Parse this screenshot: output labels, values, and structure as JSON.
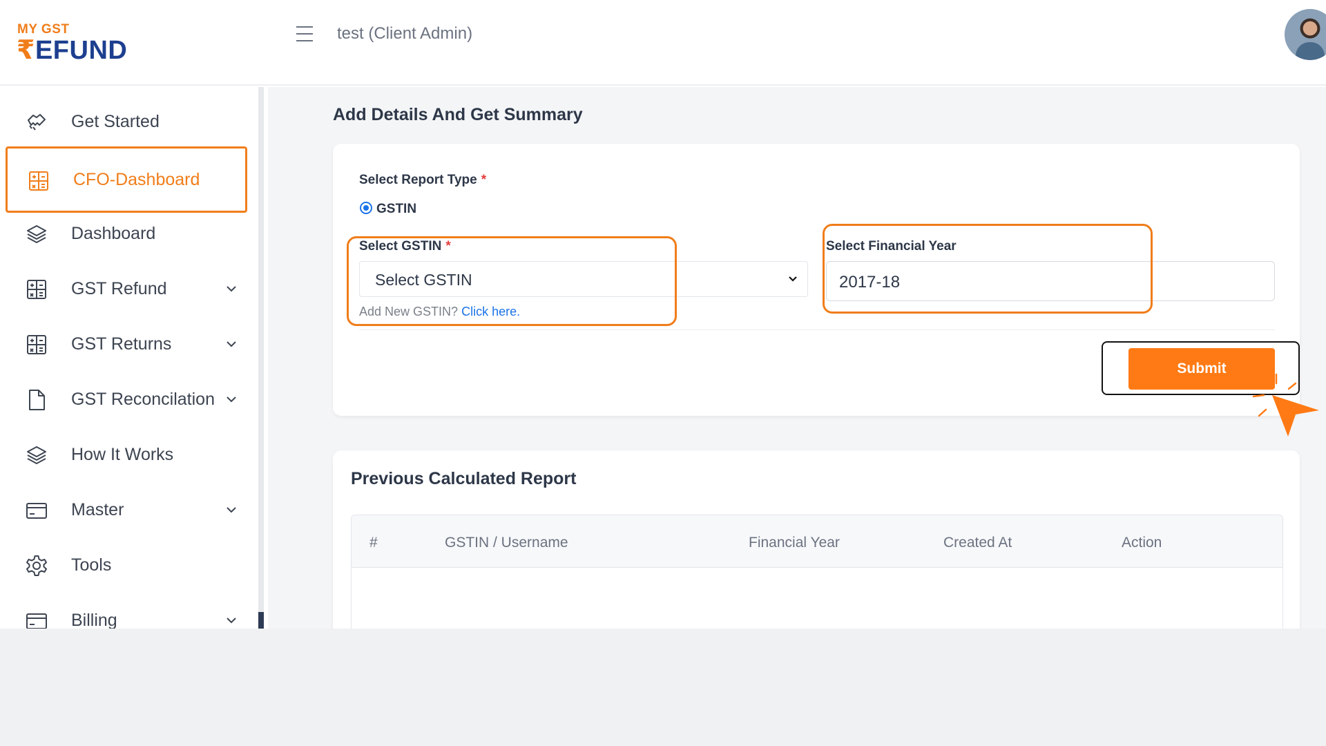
{
  "brand": {
    "logo_small": "MY GST",
    "logo_rupee": "₹",
    "logo_big": "EFUND",
    "accent": "#f07d1a",
    "navy": "#1d3f8f"
  },
  "header": {
    "user_title": "test (Client Admin)"
  },
  "sidebar": {
    "items": [
      {
        "label": "Get Started",
        "icon": "handshake-icon",
        "has_chevron": false,
        "active": false
      },
      {
        "label": "CFO-Dashboard",
        "icon": "calculator-icon",
        "has_chevron": false,
        "active": true
      },
      {
        "label": "Dashboard",
        "icon": "layers-icon",
        "has_chevron": false,
        "active": false
      },
      {
        "label": "GST Refund",
        "icon": "calculator-icon",
        "has_chevron": true,
        "active": false
      },
      {
        "label": "GST Returns",
        "icon": "calculator-icon",
        "has_chevron": true,
        "active": false
      },
      {
        "label": "GST Reconcilation",
        "icon": "file-icon",
        "has_chevron": true,
        "active": false
      },
      {
        "label": "How It Works",
        "icon": "layers-icon",
        "has_chevron": false,
        "active": false
      },
      {
        "label": "Master",
        "icon": "credit-card-icon",
        "has_chevron": true,
        "active": false
      },
      {
        "label": "Tools",
        "icon": "gear-icon",
        "has_chevron": false,
        "active": false
      },
      {
        "label": "Billing",
        "icon": "credit-card-icon",
        "has_chevron": true,
        "active": false
      }
    ]
  },
  "form": {
    "section_title": "Add Details And Get Summary",
    "report_type_label": "Select Report Type",
    "required_mark": "*",
    "radio_option": "GSTIN",
    "gstin_label": "Select GSTIN",
    "gstin_value": "Select GSTIN",
    "helper_text": "Add New GSTIN?",
    "helper_link": "Click here.",
    "fy_label": "Select Financial Year",
    "fy_value": "2017-18",
    "submit_label": "Submit"
  },
  "report": {
    "title": "Previous Calculated Report",
    "columns": [
      "#",
      "GSTIN / Username",
      "Financial Year",
      "Created At",
      "Action"
    ]
  }
}
